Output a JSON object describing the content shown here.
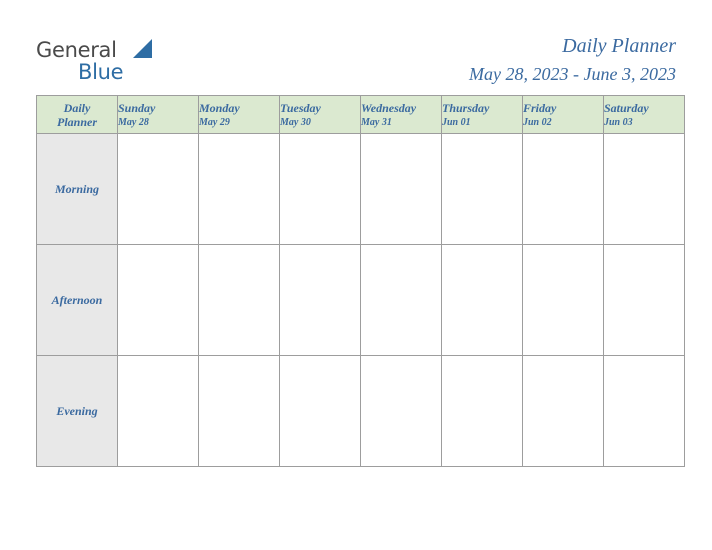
{
  "brand": {
    "word_general": "General",
    "word_blue": "Blue"
  },
  "header": {
    "title": "Daily Planner",
    "date_range": "May 28, 2023 - June 3, 2023"
  },
  "table": {
    "corner": {
      "line1": "Daily",
      "line2": "Planner"
    },
    "days": [
      {
        "name": "Sunday",
        "date": "May 28"
      },
      {
        "name": "Monday",
        "date": "May 29"
      },
      {
        "name": "Tuesday",
        "date": "May 30"
      },
      {
        "name": "Wednesday",
        "date": "May 31"
      },
      {
        "name": "Thursday",
        "date": "Jun 01"
      },
      {
        "name": "Friday",
        "date": "Jun 02"
      },
      {
        "name": "Saturday",
        "date": "Jun 03"
      }
    ],
    "rows": [
      {
        "label": "Morning",
        "cells": [
          "",
          "",
          "",
          "",
          "",
          "",
          ""
        ]
      },
      {
        "label": "Afternoon",
        "cells": [
          "",
          "",
          "",
          "",
          "",
          "",
          ""
        ]
      },
      {
        "label": "Evening",
        "cells": [
          "",
          "",
          "",
          "",
          "",
          "",
          ""
        ]
      }
    ]
  },
  "colors": {
    "accent_blue": "#3b6aa0",
    "header_green": "#dbe9d0",
    "row_label_gray": "#e8e8e8",
    "border_gray": "#9d9d9d"
  }
}
